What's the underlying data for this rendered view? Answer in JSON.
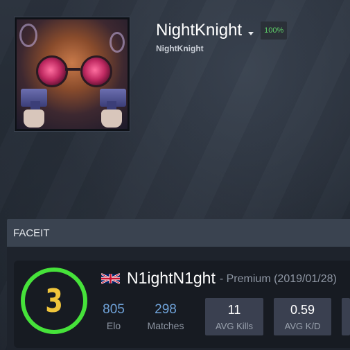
{
  "profile": {
    "username": "NightKnight",
    "completion_badge": "100%",
    "subname": "NightKnight"
  },
  "faceit": {
    "panel_title": "FACEIT",
    "level": "3",
    "player_name": "N1ightN1ght",
    "membership": "- Premium (2019/01/28)",
    "stats": [
      {
        "value": "805",
        "label": "Elo"
      },
      {
        "value": "298",
        "label": "Matches"
      }
    ],
    "boxes": [
      {
        "value": "11",
        "label": "AVG Kills"
      },
      {
        "value": "0.59",
        "label": "AVG K/D"
      }
    ]
  },
  "colors": {
    "level_ring": "#46e23a",
    "level_number": "#f0c53b",
    "badge_text": "#5fd26a",
    "stat_value": "#6fa2d8"
  },
  "icons": {
    "dropdown": "chevron-down-icon",
    "flag": "uk-flag-icon"
  }
}
